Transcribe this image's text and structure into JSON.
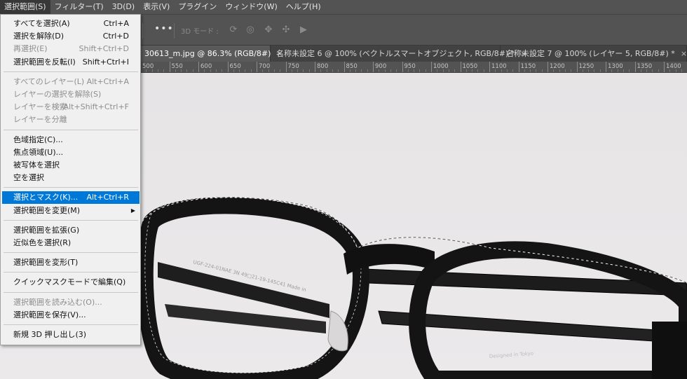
{
  "menubar": {
    "items": [
      "選択範囲(S)",
      "フィルター(T)",
      "3D(D)",
      "表示(V)",
      "プラグイン",
      "ウィンドウ(W)",
      "ヘルプ(H)"
    ]
  },
  "optionsbar": {
    "more_label": "•••",
    "mode_3d_label": "3D モード :"
  },
  "tabs": [
    {
      "label": "30613_m.jpg @ 86.3% (RGB/8#)",
      "close": "×"
    },
    {
      "label": "名称未設定 6 @ 100% (ベクトルスマートオブジェクト, RGB/8#) *",
      "close": "×"
    },
    {
      "label": "名称未設定 7 @ 100% (レイヤー 5, RGB/8#) *",
      "close": "×"
    }
  ],
  "ruler": {
    "labels": [
      "500",
      "550",
      "600",
      "650",
      "700",
      "750",
      "800",
      "850",
      "900",
      "950",
      "1000",
      "1050",
      "1100",
      "1150",
      "1200",
      "1250",
      "1300",
      "1350",
      "1400"
    ]
  },
  "dropdown": {
    "groups": [
      [
        {
          "label": "すべてを選択(A)",
          "shortcut": "Ctrl+A",
          "disabled": false
        },
        {
          "label": "選択を解除(D)",
          "shortcut": "Ctrl+D",
          "disabled": false
        },
        {
          "label": "再選択(E)",
          "shortcut": "Shift+Ctrl+D",
          "disabled": true
        },
        {
          "label": "選択範囲を反転(I)",
          "shortcut": "Shift+Ctrl+I",
          "disabled": false
        }
      ],
      [
        {
          "label": "すべてのレイヤー(L)",
          "shortcut": "Alt+Ctrl+A",
          "disabled": true
        },
        {
          "label": "レイヤーの選択を解除(S)",
          "shortcut": "",
          "disabled": true
        },
        {
          "label": "レイヤーを検索",
          "shortcut": "Alt+Shift+Ctrl+F",
          "disabled": true
        },
        {
          "label": "レイヤーを分離",
          "shortcut": "",
          "disabled": true
        }
      ],
      [
        {
          "label": "色域指定(C)...",
          "shortcut": "",
          "disabled": false
        },
        {
          "label": "焦点領域(U)...",
          "shortcut": "",
          "disabled": false
        },
        {
          "label": "被写体を選択",
          "shortcut": "",
          "disabled": false
        },
        {
          "label": "空を選択",
          "shortcut": "",
          "disabled": false
        }
      ],
      [
        {
          "label": "選択とマスク(K)...",
          "shortcut": "Alt+Ctrl+R",
          "disabled": false,
          "highlighted": true
        },
        {
          "label": "選択範囲を変更(M)",
          "shortcut": "",
          "disabled": false,
          "submenu": true
        }
      ],
      [
        {
          "label": "選択範囲を拡張(G)",
          "shortcut": "",
          "disabled": false
        },
        {
          "label": "近似色を選択(R)",
          "shortcut": "",
          "disabled": false
        }
      ],
      [
        {
          "label": "選択範囲を変形(T)",
          "shortcut": "",
          "disabled": false
        }
      ],
      [
        {
          "label": "クイックマスクモードで編集(Q)",
          "shortcut": "",
          "disabled": false
        }
      ],
      [
        {
          "label": "選択範囲を読み込む(O)...",
          "shortcut": "",
          "disabled": true
        },
        {
          "label": "選択範囲を保存(V)...",
          "shortcut": "",
          "disabled": false
        }
      ],
      [
        {
          "label": "新規 3D 押し出し(3)",
          "shortcut": "",
          "disabled": false
        }
      ]
    ]
  },
  "canvas": {
    "frame_text_left": "UGF-224-01NAE 3N 49□21-19-145C41 Made in",
    "frame_text_right": "Designed in Tokyo",
    "colors": {
      "background": "#e8e6e7",
      "frame": "#151515",
      "highlight": "#0078d7"
    }
  }
}
